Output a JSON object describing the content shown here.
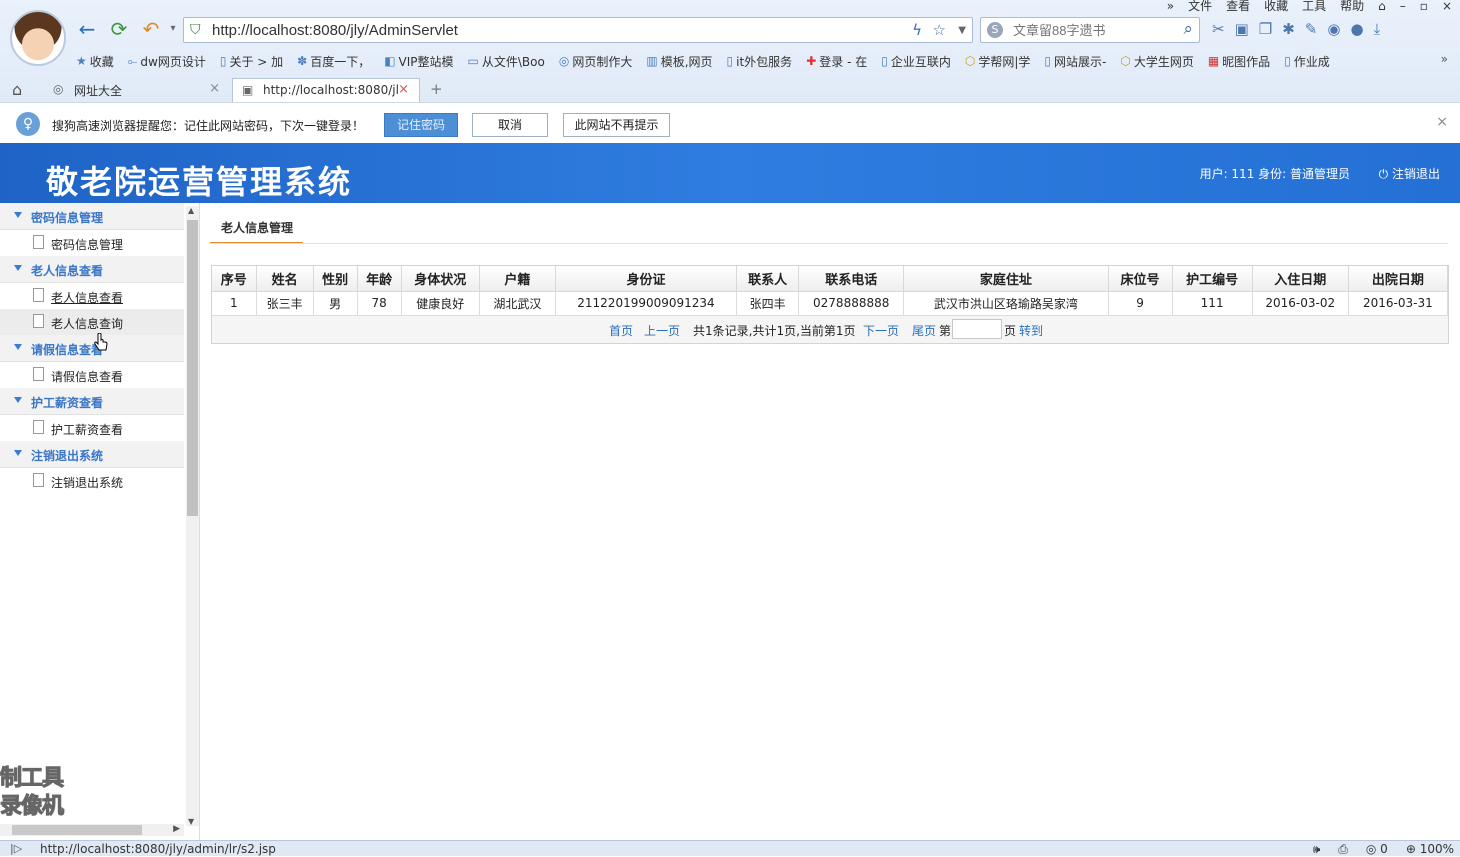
{
  "browser": {
    "menu": [
      "文件",
      "查看",
      "收藏",
      "工具",
      "帮助"
    ],
    "address": "http://localhost:8080/jly/AdminServlet",
    "search_placeholder": "文章留88字遗书",
    "bookmarks": [
      "收藏",
      "dw网页设计",
      "关于 > 加",
      "百度一下，",
      "VIP整站模",
      "从文件\\Boo",
      "网页制作大",
      "模板,网页",
      "it外包服务",
      "登录 - 在",
      "企业互联内",
      "学帮网|学",
      "网站展示-",
      "大学生网页",
      "昵图作品",
      "作业成"
    ],
    "tabs": [
      {
        "label": "网址大全"
      },
      {
        "label": "http://localhost:8080/jl"
      }
    ],
    "notify": {
      "message": "搜狗高速浏览器提醒您：记住此网站密码，下次一键登录！",
      "remember": "记住密码",
      "cancel": "取消",
      "never": "此网站不再提示"
    },
    "status_url": "http://localhost:8080/jly/admin/lr/s2.jsp",
    "status_count": "0",
    "zoom": "100%"
  },
  "app": {
    "title": "敬老院运营管理系统",
    "user_info": "用户: 111 身份: 普通管理员",
    "logout": "注销退出"
  },
  "sidebar": {
    "groups": [
      {
        "label": "密码信息管理",
        "items": [
          "密码信息管理"
        ]
      },
      {
        "label": "老人信息查看",
        "items": [
          "老人信息查看",
          "老人信息查询"
        ]
      },
      {
        "label": "请假信息查看",
        "items": [
          "请假信息查看"
        ]
      },
      {
        "label": "护工薪资查看",
        "items": [
          "护工薪资查看"
        ]
      },
      {
        "label": "注销退出系统",
        "items": [
          "注销退出系统"
        ]
      }
    ]
  },
  "watermark": [
    "制工具",
    "录像机"
  ],
  "content": {
    "tab": "老人信息管理",
    "columns": [
      "序号",
      "姓名",
      "性别",
      "年龄",
      "身体状况",
      "户籍",
      "身份证",
      "联系人",
      "联系电话",
      "家庭住址",
      "床位号",
      "护工编号",
      "入住日期",
      "出院日期"
    ],
    "rows": [
      [
        "1",
        "张三丰",
        "男",
        "78",
        "健康良好",
        "湖北武汉",
        "211220199009091234",
        "张四丰",
        "0278888888",
        "武汉市洪山区珞瑜路吴家湾",
        "9",
        "111",
        "2016-03-02",
        "2016-03-31"
      ]
    ],
    "pager": {
      "first": "首页",
      "prev": "上一页",
      "summary": "共1条记录,共计1页,当前第1页",
      "next": "下一页",
      "last": "尾页",
      "page_prefix": "第",
      "page_suffix": "页",
      "go": "转到"
    }
  }
}
